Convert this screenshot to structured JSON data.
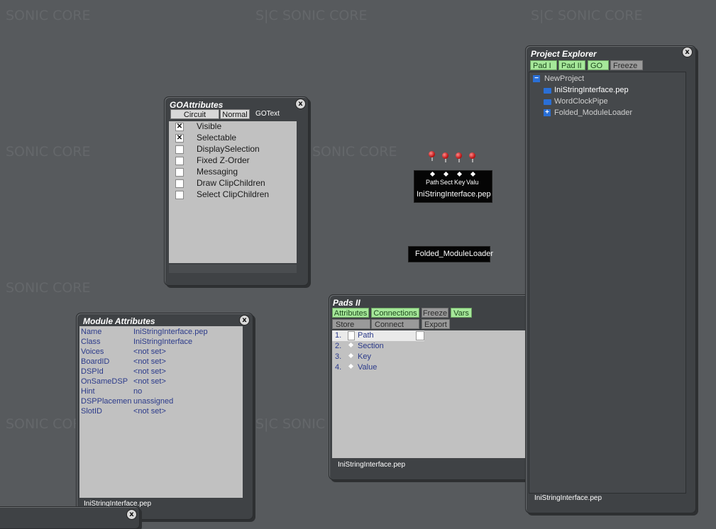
{
  "watermark": {
    "text": "SONIC CORE",
    "logo": "S|C"
  },
  "goattributes": {
    "title": "GOAttributes",
    "tabs": [
      "Circuit",
      "Normal",
      "GOText"
    ],
    "items": [
      {
        "label": "Visible",
        "checked": true,
        "mark": "✕"
      },
      {
        "label": "Selectable",
        "checked": true,
        "mark": "✕"
      },
      {
        "label": "DisplaySelection",
        "checked": false,
        "mark": ""
      },
      {
        "label": "Fixed Z-Order",
        "checked": false,
        "mark": ""
      },
      {
        "label": "Messaging",
        "checked": false,
        "mark": ""
      },
      {
        "label": "Draw ClipChildren",
        "checked": false,
        "mark": ""
      },
      {
        "label": "Select ClipChildren",
        "checked": false,
        "mark": ""
      }
    ]
  },
  "module_attributes": {
    "title": "Module Attributes",
    "rows": [
      {
        "key": "Name",
        "value": "IniStringInterface.pep"
      },
      {
        "key": "Class",
        "value": "IniStringInterface"
      },
      {
        "key": "Voices",
        "value": "<not set>"
      },
      {
        "key": "BoardID",
        "value": "<not set>"
      },
      {
        "key": "DSPId",
        "value": "<not set>"
      },
      {
        "key": "OnSameDSP",
        "value": "<not set>"
      },
      {
        "key": "Hint",
        "value": "no"
      },
      {
        "key": "DSPPlacemen",
        "value": "unassigned"
      },
      {
        "key": "SlotID",
        "value": "<not set>"
      }
    ],
    "status": "IniStringInterface.pep"
  },
  "node": {
    "pins": [
      "Path",
      "Sect",
      "Key",
      "Valu"
    ],
    "name": "IniStringInterface.pep"
  },
  "folded_node": {
    "name": "Folded_ModuleLoader"
  },
  "pads": {
    "title": "Pads II",
    "tabs_row1": [
      "Attributes",
      "Connections",
      "Freeze",
      "Vars"
    ],
    "tabs_row2": [
      "Store",
      "Connect",
      "Export"
    ],
    "rows": [
      {
        "num": "1.",
        "label": "Path"
      },
      {
        "num": "2.",
        "label": "Section"
      },
      {
        "num": "3.",
        "label": "Key"
      },
      {
        "num": "4.",
        "label": "Value"
      }
    ],
    "status": "IniStringInterface.pep"
  },
  "project_explorer": {
    "title": "Project Explorer",
    "tabs": [
      "Pad I",
      "Pad II",
      "GO",
      "Freeze"
    ],
    "tree": [
      {
        "label": "NewProject",
        "expander": "−"
      },
      {
        "label": "IniStringInterface.pep",
        "expander": ""
      },
      {
        "label": "WordClockPipe",
        "expander": ""
      },
      {
        "label": "Folded_ModuleLoader",
        "expander": "+"
      }
    ],
    "status": "IniStringInterface.pep"
  },
  "close_glyph": "x",
  "colors": {
    "background": "#575a5d",
    "panel": "#3f4245",
    "tab_green": "#a6e89a",
    "text_blue": "#2b3a8a"
  }
}
